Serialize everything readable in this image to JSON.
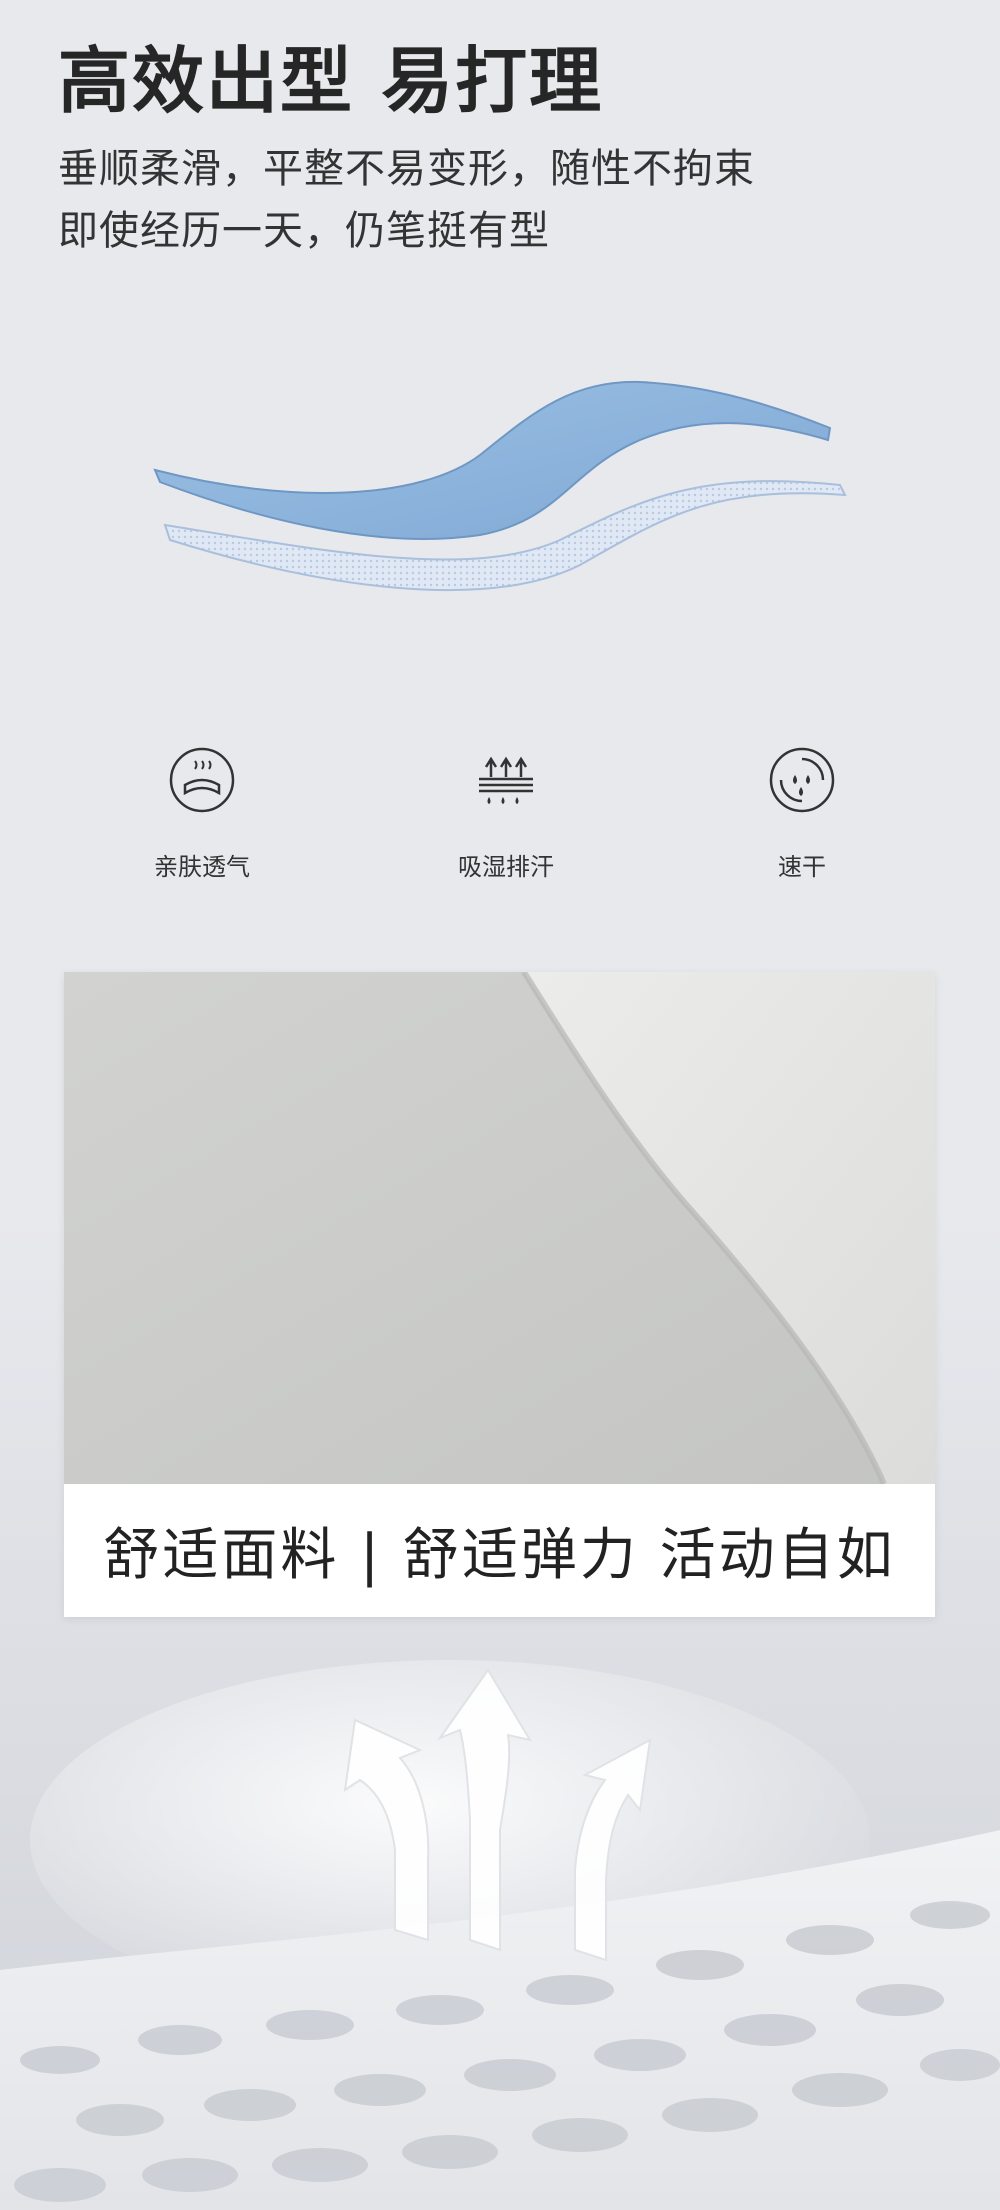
{
  "header": {
    "title": "高效出型 易打理",
    "subtitle_lines": [
      "垂顺柔滑，平整不易变形，随性不拘束",
      "即使经历一天，仍笔挺有型"
    ]
  },
  "features": [
    {
      "label": "亲肤透气",
      "icon": "breathable-fabric-icon"
    },
    {
      "label": "吸湿排汗",
      "icon": "moisture-wicking-icon"
    },
    {
      "label": "速干",
      "icon": "quick-dry-icon"
    }
  ],
  "photo": {
    "caption": "舒适面料  |  舒适弹力 活动自如"
  },
  "colors": {
    "background": "#e8e9ed",
    "fabric_blue": "#8fb6dc",
    "text_dark": "#262626"
  }
}
